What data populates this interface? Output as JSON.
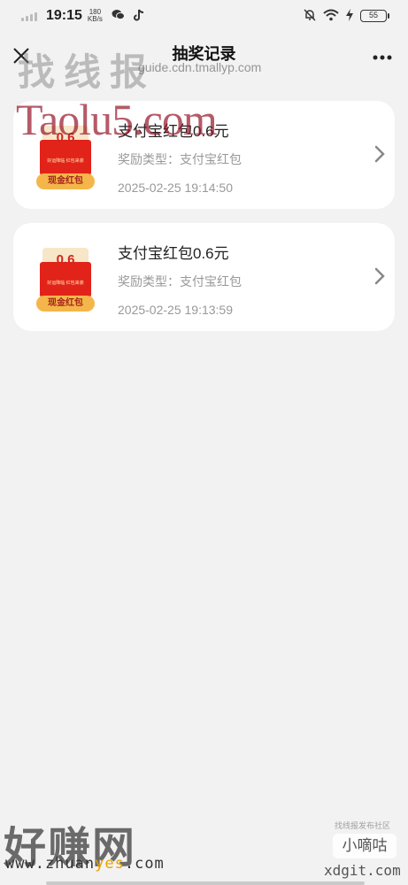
{
  "status_bar": {
    "time": "19:15",
    "net_speed_value": "180",
    "net_speed_unit": "KB/s",
    "battery": "55",
    "icons": [
      "signal-icon",
      "wechat-icon",
      "tiktok-icon",
      "mute-icon",
      "wifi-icon",
      "charging-icon",
      "battery-icon"
    ]
  },
  "header": {
    "title": "抽奖记录",
    "close_icon": "×",
    "more_icon": "•••"
  },
  "records": [
    {
      "title": "支付宝红包0.6元",
      "type": "奖励类型：支付宝红包",
      "date": "2025-02-25 19:14:50",
      "envelope_amount": "0.6",
      "envelope_ribbon": "现金红包",
      "envelope_small": "好运降临 红包来袭"
    },
    {
      "title": "支付宝红包0.6元",
      "type": "奖励类型：支付宝红包",
      "date": "2025-02-25 19:13:59",
      "envelope_amount": "0.6",
      "envelope_ribbon": "现金红包",
      "envelope_small": "好运降临 红包来袭"
    }
  ],
  "watermarks": {
    "zhaoxianbao": "找线报",
    "domain": "guide.cdn.tmallyp.com",
    "taolu": "Taolu5.com",
    "haozhuan": "好赚网",
    "zhuanyes_pre": "www.zhuan",
    "zhuanyes_hl": "yes",
    "zhuanyes_post": ".com",
    "community": "找线报发布社区",
    "xiaodigu": "小嘀咕",
    "xdgit": "xdgit.com"
  },
  "colors": {
    "background": "#f2f2f2",
    "card": "#ffffff",
    "envelope_red": "#e2231a",
    "ribbon_gold": "#f4b64a",
    "secondary_text": "#999999"
  }
}
